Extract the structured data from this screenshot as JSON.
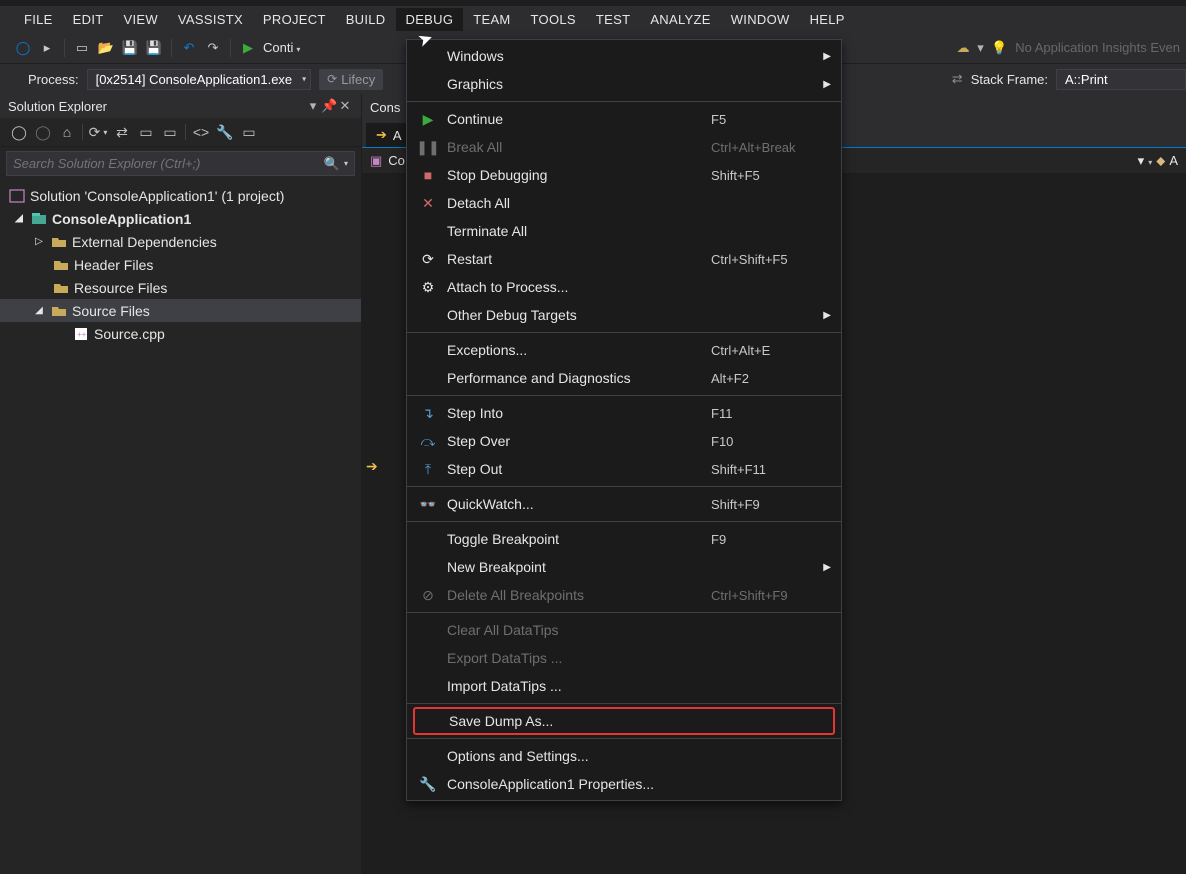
{
  "menubar": [
    "FILE",
    "EDIT",
    "VIEW",
    "VASSISTX",
    "PROJECT",
    "BUILD",
    "DEBUG",
    "TEAM",
    "TOOLS",
    "TEST",
    "ANALYZE",
    "WINDOW",
    "HELP"
  ],
  "toolbar": {
    "continue_label": "Conti",
    "insights_label": "No Application Insights Even"
  },
  "subbar": {
    "process_label": "Process:",
    "process_value": "[0x2514] ConsoleApplication1.exe",
    "lifecycle_label": "Lifecy",
    "stack_label": "Stack Frame:",
    "stack_value": "A::Print"
  },
  "solution_explorer": {
    "title": "Solution Explorer",
    "search_placeholder": "Search Solution Explorer (Ctrl+;)",
    "nodes": {
      "solution": "Solution 'ConsoleApplication1' (1 project)",
      "project": "ConsoleApplication1",
      "ext_deps": "External Dependencies",
      "header_files": "Header Files",
      "resource_files": "Resource Files",
      "source_files": "Source Files",
      "source_cpp": "Source.cpp"
    }
  },
  "editor": {
    "tab1": "A",
    "tab2": "Co",
    "nav_name": "A",
    "nav_right": "Cons"
  },
  "debug_menu": {
    "windows": "Windows",
    "graphics": "Graphics",
    "continue": {
      "label": "Continue",
      "key": "F5"
    },
    "break_all": {
      "label": "Break All",
      "key": "Ctrl+Alt+Break"
    },
    "stop": {
      "label": "Stop Debugging",
      "key": "Shift+F5"
    },
    "detach": {
      "label": "Detach All"
    },
    "terminate": {
      "label": "Terminate All"
    },
    "restart": {
      "label": "Restart",
      "key": "Ctrl+Shift+F5"
    },
    "attach": {
      "label": "Attach to Process..."
    },
    "other_targets": {
      "label": "Other Debug Targets"
    },
    "exceptions": {
      "label": "Exceptions...",
      "key": "Ctrl+Alt+E"
    },
    "perf_diag": {
      "label": "Performance and Diagnostics",
      "key": "Alt+F2"
    },
    "step_into": {
      "label": "Step Into",
      "key": "F11"
    },
    "step_over": {
      "label": "Step Over",
      "key": "F10"
    },
    "step_out": {
      "label": "Step Out",
      "key": "Shift+F11"
    },
    "quickwatch": {
      "label": "QuickWatch...",
      "key": "Shift+F9"
    },
    "toggle_bp": {
      "label": "Toggle Breakpoint",
      "key": "F9"
    },
    "new_bp": {
      "label": "New Breakpoint"
    },
    "del_bp": {
      "label": "Delete All Breakpoints",
      "key": "Ctrl+Shift+F9"
    },
    "clear_tips": {
      "label": "Clear All DataTips"
    },
    "export_tips": {
      "label": "Export DataTips ..."
    },
    "import_tips": {
      "label": "Import DataTips ..."
    },
    "save_dump": {
      "label": "Save Dump As..."
    },
    "opts": {
      "label": "Options and Settings..."
    },
    "props": {
      "label": "ConsoleApplication1 Properties..."
    }
  }
}
